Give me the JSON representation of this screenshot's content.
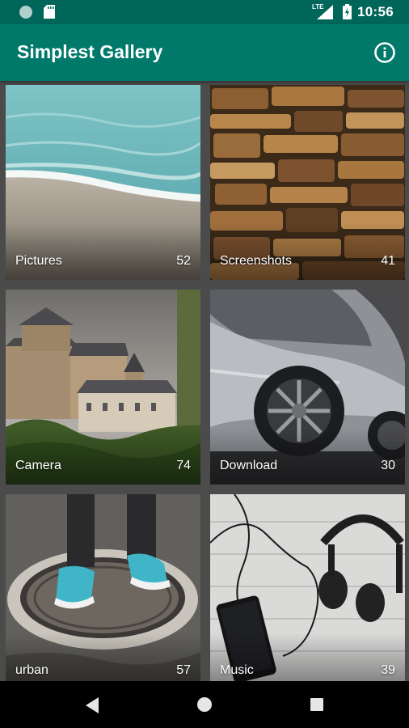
{
  "status_bar": {
    "time": "10:56",
    "network_label": "LTE",
    "icons": [
      "notification-dot-icon",
      "sd-card-icon",
      "signal-icon",
      "battery-icon"
    ]
  },
  "app_bar": {
    "title": "Simplest Gallery",
    "info_icon": "info-icon",
    "color": "#00796b",
    "status_color": "#00665a"
  },
  "folders": [
    {
      "name": "Pictures",
      "count": "52",
      "thumb": "beach-waves"
    },
    {
      "name": "Screenshots",
      "count": "41",
      "thumb": "stone-wall"
    },
    {
      "name": "Camera",
      "count": "74",
      "thumb": "castle"
    },
    {
      "name": "Download",
      "count": "30",
      "thumb": "silver-car"
    },
    {
      "name": "urban",
      "count": "57",
      "thumb": "sneakers-manhole"
    },
    {
      "name": "Music",
      "count": "39",
      "thumb": "headphones-phone"
    }
  ],
  "nav_bar": {
    "icons": [
      "back-icon",
      "home-icon",
      "recents-icon"
    ]
  }
}
